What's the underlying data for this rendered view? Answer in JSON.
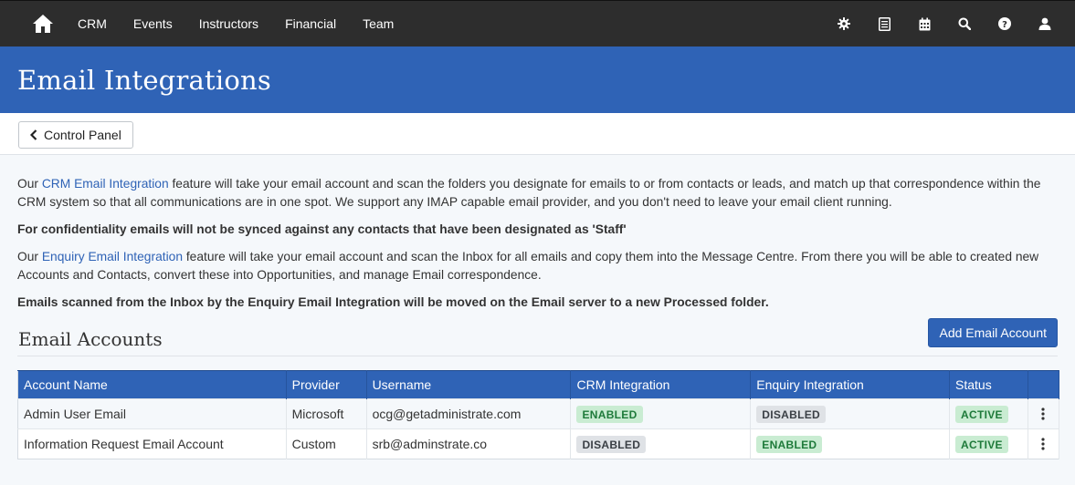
{
  "nav": {
    "items": [
      {
        "id": "crm",
        "label": "CRM"
      },
      {
        "id": "events",
        "label": "Events"
      },
      {
        "id": "instructors",
        "label": "Instructors"
      },
      {
        "id": "financial",
        "label": "Financial"
      },
      {
        "id": "team",
        "label": "Team"
      }
    ],
    "icons": [
      "gear-icon",
      "document-icon",
      "calendar-icon",
      "search-icon",
      "help-icon",
      "user-icon"
    ]
  },
  "page": {
    "title": "Email Integrations",
    "back_label": "Control Panel"
  },
  "intro": {
    "p1_prefix": "Our ",
    "p1_link": "CRM Email Integration",
    "p1_rest": " feature will take your email account and scan the folders you designate for emails to or from contacts or leads, and match up that correspondence within the CRM system so that all communications are in one spot. We support any IMAP capable email provider, and you don't need to leave your email client running.",
    "p2": "For confidentiality emails will not be synced against any contacts that have been designated as 'Staff'",
    "p3_prefix": "Our ",
    "p3_link": "Enquiry Email Integration",
    "p3_rest": " feature will take your email account and scan the Inbox for all emails and copy them into the Message Centre. From there you will be able to created new Accounts and Contacts, convert these into Opportunities, and manage Email correspondence.",
    "p4": "Emails scanned from the Inbox by the Enquiry Email Integration will be moved on the Email server to a new Processed folder."
  },
  "accounts": {
    "heading": "Email Accounts",
    "add_label": "Add Email Account",
    "columns": {
      "account_name": "Account Name",
      "provider": "Provider",
      "username": "Username",
      "crm": "CRM Integration",
      "enquiry": "Enquiry Integration",
      "status": "Status"
    },
    "rows": [
      {
        "account_name": "Admin User Email",
        "provider": "Microsoft",
        "username": "ocg@getadministrate.com",
        "crm": "ENABLED",
        "enquiry": "DISABLED",
        "status": "ACTIVE"
      },
      {
        "account_name": "Information Request Email Account",
        "provider": "Custom",
        "username": "srb@adminstrate.co",
        "crm": "DISABLED",
        "enquiry": "ENABLED",
        "status": "ACTIVE"
      }
    ]
  },
  "colors": {
    "nav_bg": "#2d2d2d",
    "brand_blue": "#2f63b6",
    "enabled_bg": "#c9ecd2",
    "enabled_text": "#1e7a3a",
    "disabled_bg": "#dfe2e6"
  }
}
